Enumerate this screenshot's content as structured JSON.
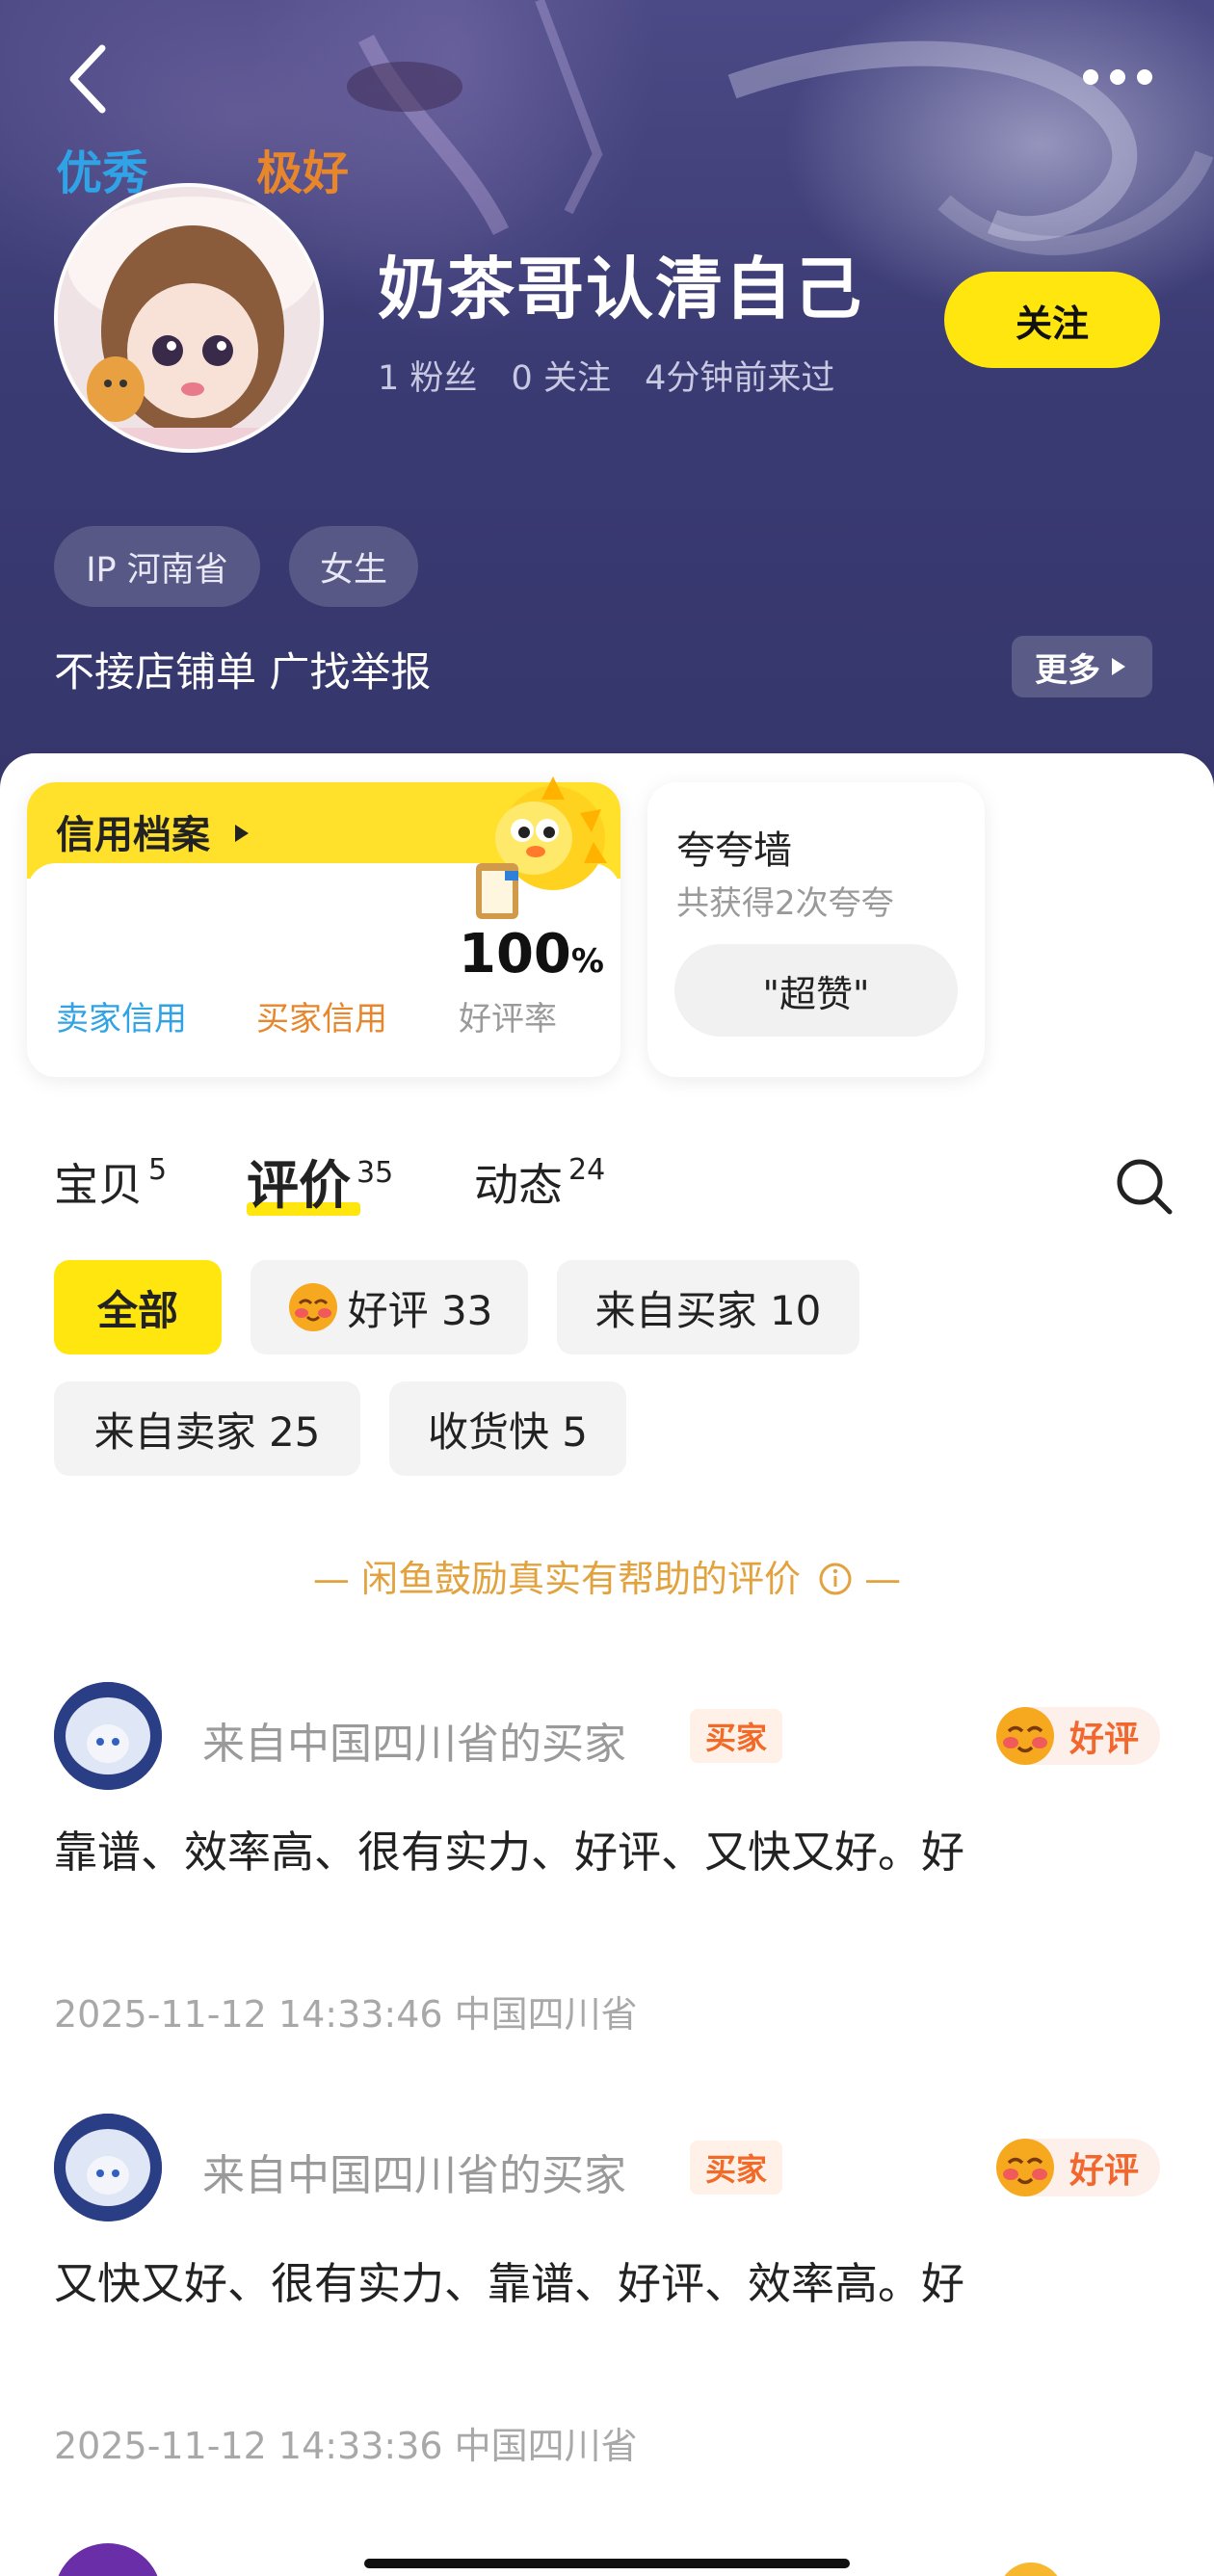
{
  "header": {
    "username": "奶茶哥认清自己",
    "stats": {
      "fans": "1 粉丝",
      "following": "0 关注",
      "last_seen": "4分钟前来过"
    },
    "follow_label": "关注",
    "tags": [
      "IP 河南省",
      "女生"
    ],
    "bio": "不接店铺单 广找举报",
    "more_label": "更多"
  },
  "credit": {
    "title": "信用档案",
    "seller": {
      "value": "优秀",
      "label": "卖家信用",
      "color": "#2fa3e6"
    },
    "buyer": {
      "value": "极好",
      "label": "买家信用",
      "color": "#e8862c"
    },
    "rate": {
      "value": "100",
      "unit": "%",
      "label": "好评率"
    }
  },
  "praise": {
    "title": "夸夸墙",
    "subtitle": "共获得2次夸夸",
    "chip": "\"超赞\""
  },
  "tabs": [
    {
      "label": "宝贝",
      "count": "5"
    },
    {
      "label": "评价",
      "count": "35",
      "active": true
    },
    {
      "label": "动态",
      "count": "24"
    }
  ],
  "filters": {
    "all": "全部",
    "good": "好评 33",
    "from_buyer": "来自买家 10",
    "from_seller": "来自卖家 25",
    "fast_delivery": "收货快 5"
  },
  "notice": "— 闲鱼鼓励真实有帮助的评价",
  "reviews": [
    {
      "user": "来自中国四川省的买家",
      "badge": "买家",
      "rating": "好评",
      "text": "靠谱、效率高、很有实力、好评、又快又好。好",
      "meta": "2025-11-12 14:33:46 中国四川省"
    },
    {
      "user": "来自中国四川省的买家",
      "badge": "买家",
      "rating": "好评",
      "text": "又快又好、很有实力、靠谱、好评、效率高。好",
      "meta": "2025-11-12 14:33:36 中国四川省"
    }
  ],
  "colors": {
    "accent_yellow": "#ffe60f",
    "header_bg": "#3b3b74",
    "seller_blue": "#2fa3e6",
    "buyer_orange": "#e8862c",
    "notice_orange": "#e2a23d"
  },
  "icons": {
    "back": "back-arrow-icon",
    "more": "more-dots-icon",
    "search": "search-icon",
    "info": "info-icon",
    "emoji": "blush-emoji-icon"
  }
}
